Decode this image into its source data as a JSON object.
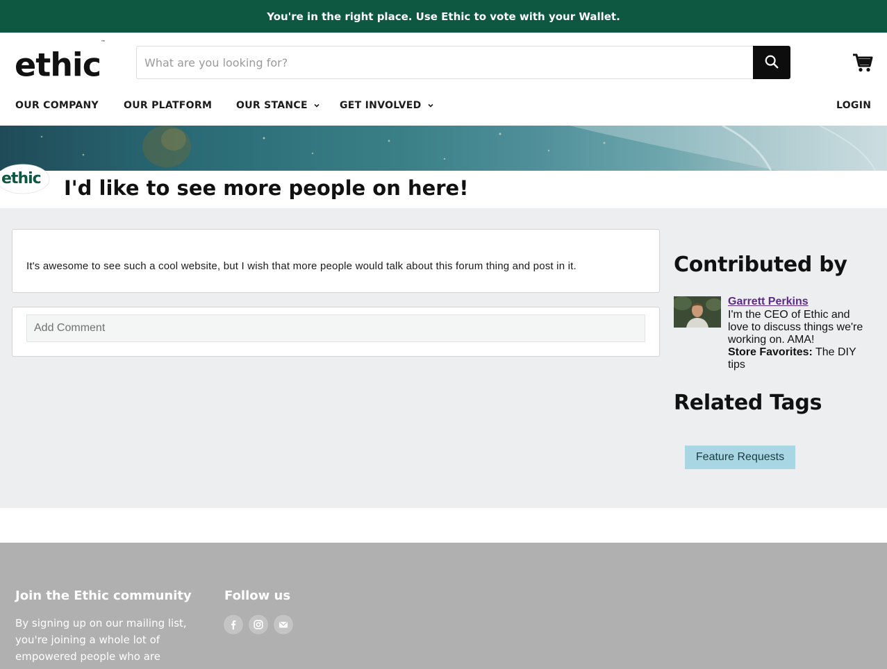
{
  "announcement": {
    "text": "You're in the right place. Use Ethic to vote with your Wallet."
  },
  "header": {
    "logo_text": "ethic",
    "logo_tm": "™",
    "search_placeholder": "What are you looking for?",
    "search_icon": "search-icon",
    "cart_icon": "cart-icon"
  },
  "nav": {
    "items": [
      {
        "label": "OUR COMPANY",
        "has_dropdown": false
      },
      {
        "label": "OUR PLATFORM",
        "has_dropdown": false
      },
      {
        "label": "OUR STANCE",
        "has_dropdown": true
      },
      {
        "label": "GET INVOLVED",
        "has_dropdown": true
      }
    ],
    "login_label": "LOGIN"
  },
  "post": {
    "badge_text": "ethic",
    "title": "I'd like to see more people on here!",
    "body": "It's awesome to see such a cool website, but I wish that more people would talk about this forum thing and post in it.",
    "comment_placeholder": "Add Comment"
  },
  "sidebar": {
    "contributed_heading": "Contributed by",
    "author_name": "Garrett Perkins",
    "author_bio": "I'm the CEO of Ethic and love to discuss things we're working on. AMA!",
    "favorites_label": "Store Favorites:",
    "favorites_value": " The DIY tips",
    "tags_heading": "Related Tags",
    "tags": [
      "Feature Requests"
    ]
  },
  "footer": {
    "join_heading": "Join the Ethic community",
    "join_text": "By signing up on our mailing list, you're joining a whole lot of empowered people who are",
    "follow_heading": "Follow us",
    "social_icons": [
      "facebook-icon",
      "instagram-icon",
      "email-icon"
    ]
  },
  "colors": {
    "announcement_bg": "#0e5740",
    "content_bg": "#eceeef",
    "tag_bg": "#a8d6e3",
    "author_link": "#5c2b8a",
    "footer_bg": "#b0b0b0"
  }
}
